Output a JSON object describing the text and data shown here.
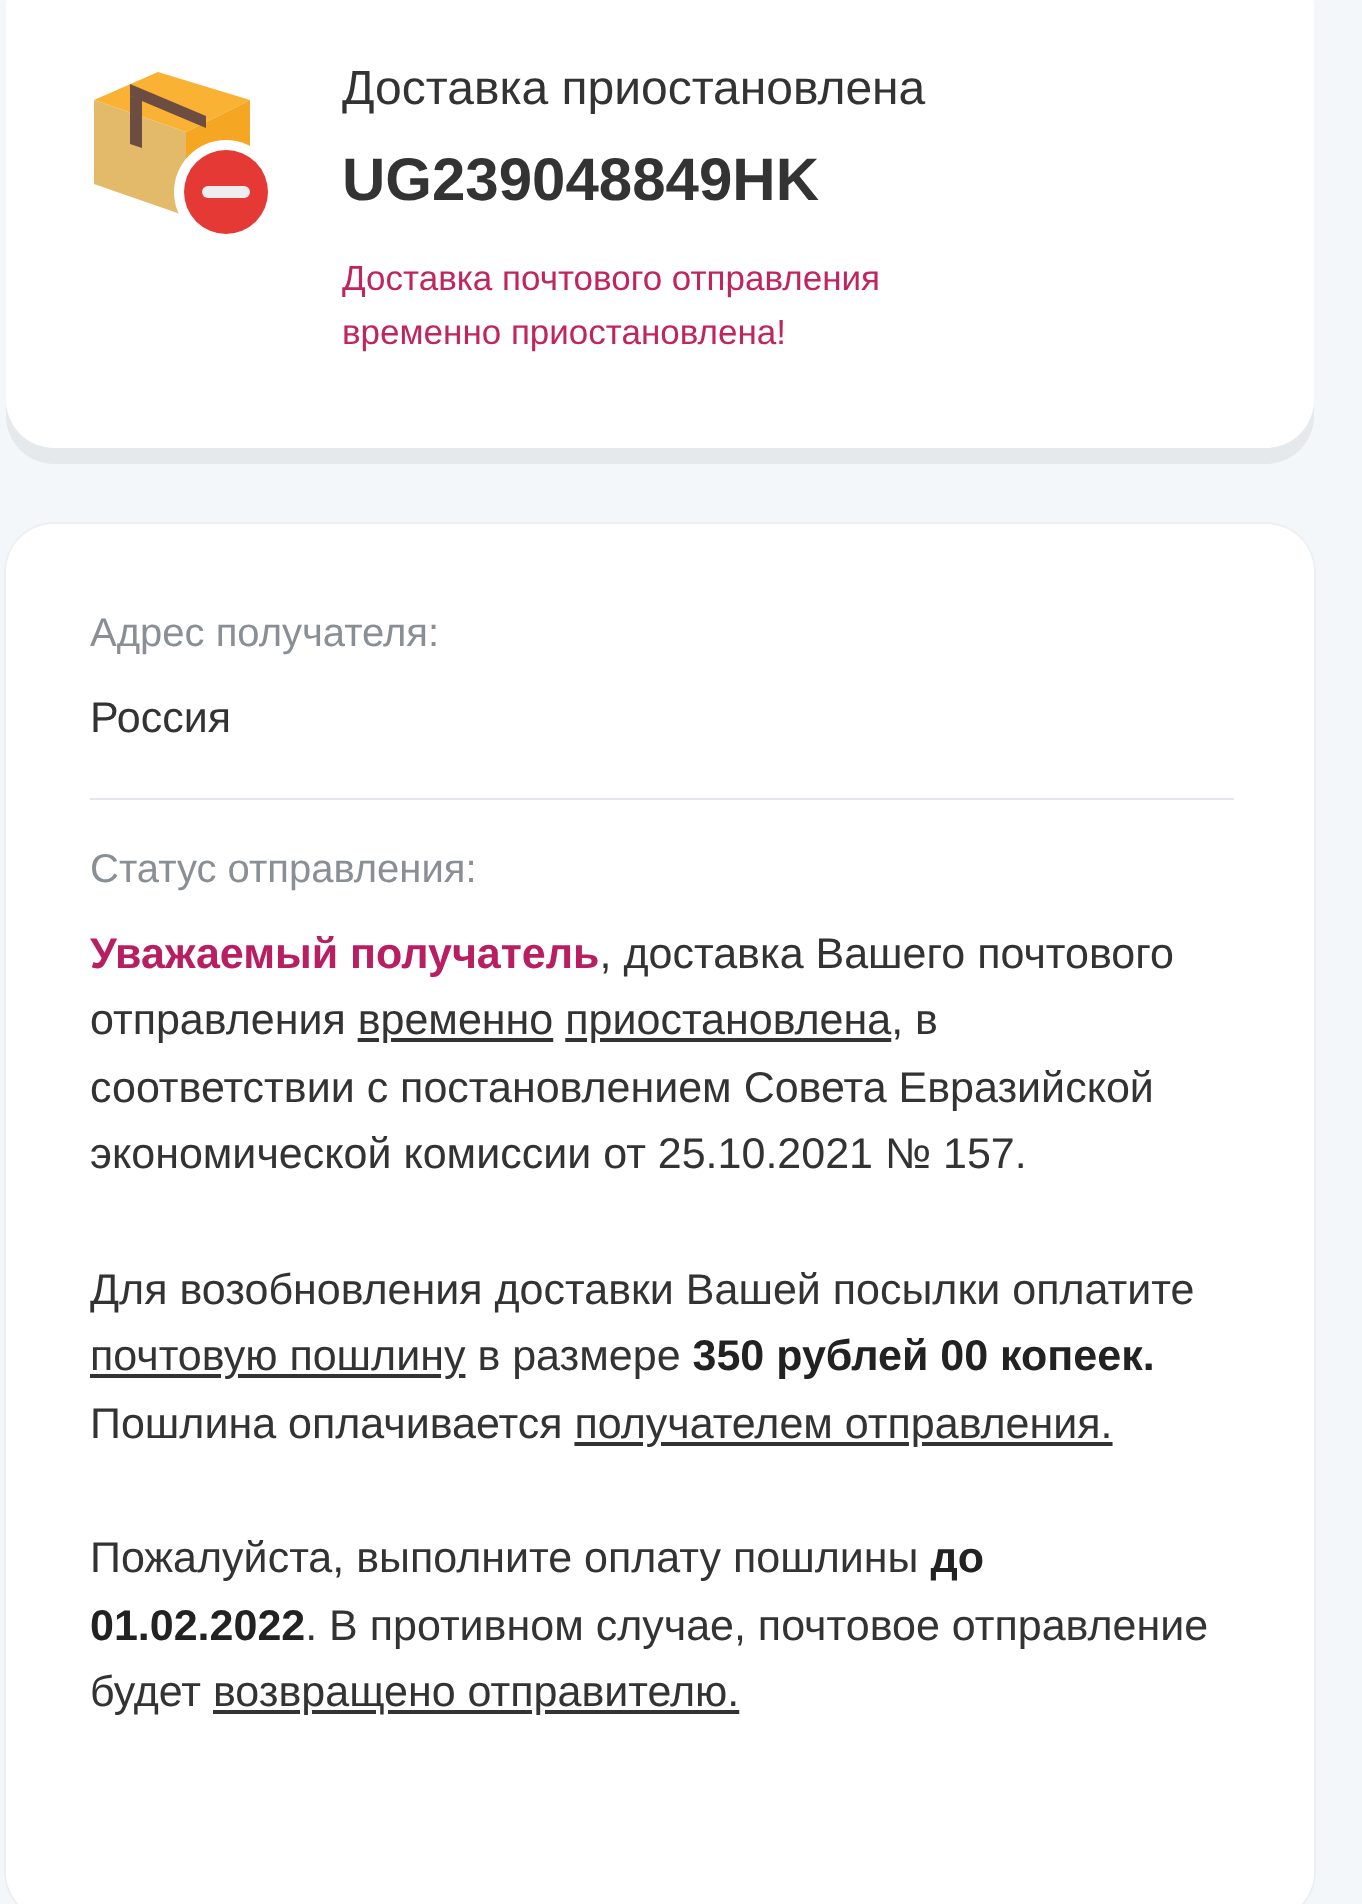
{
  "status_card": {
    "title": "Доставка приостановлена",
    "tracking_number": "UG239048849HK",
    "notice": "Доставка почтового отправления временно приостановлена!"
  },
  "details_card": {
    "sections": [
      {
        "label": "Адрес получателя:",
        "paragraphs": [
          [
            {
              "kind": "plain",
              "text": "Россия"
            }
          ]
        ]
      },
      {
        "label": "Статус отправления:",
        "paragraphs": [
          [
            {
              "kind": "accent",
              "text": "Уважаемый получатель"
            },
            {
              "kind": "plain",
              "text": ", доставка Вашего почтового отправления "
            },
            {
              "kind": "link",
              "text": "временно"
            },
            {
              "kind": "link",
              "text": "приостановлена"
            },
            {
              "kind": "plain",
              "text": ", в соответствии с постановлением Совета Евразийской экономической комиссии от 25.10.2021 № 157."
            }
          ],
          [
            {
              "kind": "plain",
              "text": "Для возобновления доставки Вашей посылки оплатите "
            },
            {
              "kind": "link",
              "text": "почтовую пошлину"
            },
            {
              "kind": "plain",
              "text": " в размере "
            },
            {
              "kind": "strong",
              "text": "350 рублей 00 копеек."
            },
            {
              "kind": "plain",
              "text": " Пошлина оплачивается "
            },
            {
              "kind": "link",
              "text": "получателем отправления."
            }
          ],
          [
            {
              "kind": "plain",
              "text": "Пожалуйста, выполните оплату пошлины "
            },
            {
              "kind": "strong",
              "text": "до 01.02.2022"
            },
            {
              "kind": "plain",
              "text": ". В противном случае, почтовое отправление будет "
            },
            {
              "kind": "link",
              "text": "возвращено отправителю."
            }
          ]
        ]
      }
    ]
  }
}
